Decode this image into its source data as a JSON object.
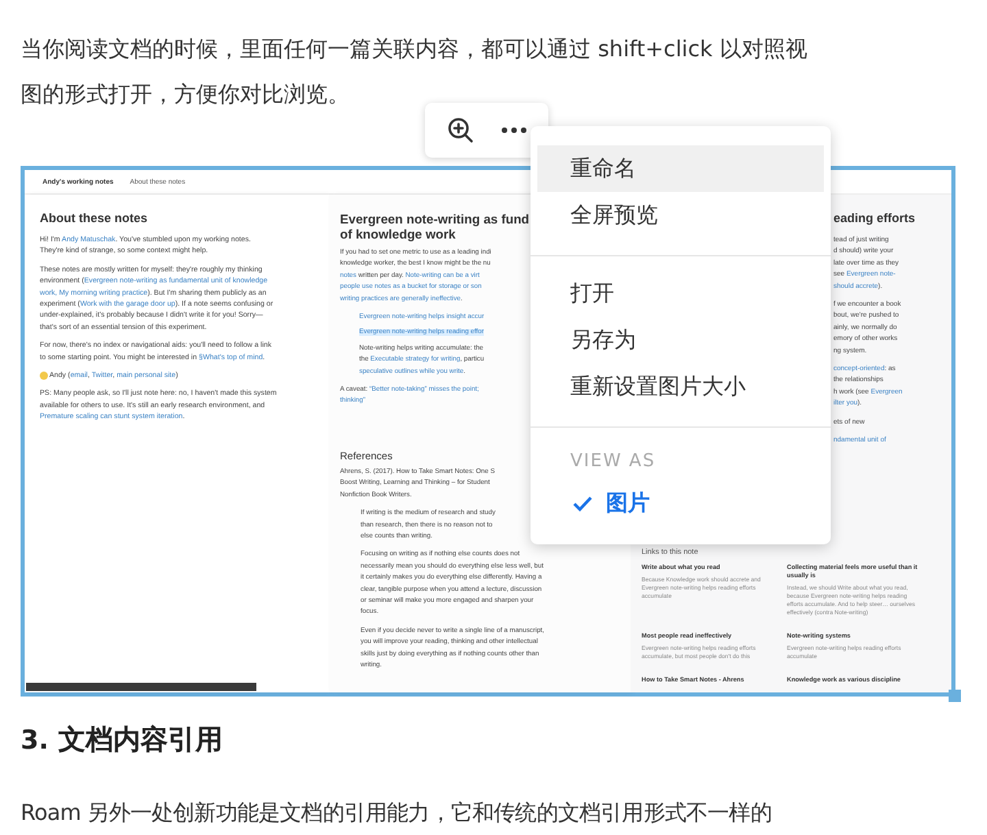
{
  "intro": "当你阅读文档的时候，里面任何一篇关联内容，都可以通过 shift+click 以对照视图的形式打开，方便你对比浏览。",
  "toolbar": [
    {
      "kind": "zoom"
    },
    {
      "kind": "more"
    }
  ],
  "embed": {
    "brand": "Andy's working notes",
    "nav_link": "About these notes",
    "col1": {
      "title": "About these notes",
      "blocks": [
        {
          "kind": "p",
          "lines": [
            [
              "Hi! I'm ",
              {
                "link": "Andy Matuschak"
              },
              ". You've stumbled upon my working notes."
            ],
            [
              "They're kind of strange, so some context might help."
            ]
          ]
        },
        {
          "kind": "p",
          "lines": [
            [
              "These notes are mostly written for myself: they're roughly my thinking"
            ],
            [
              "environment (",
              {
                "link": "Evergreen note-writing as fundamental unit of knowledge"
              }
            ],
            [
              {
                "link": "work, My morning writing practice"
              },
              "). But I'm sharing them publicly as an"
            ],
            [
              "experiment (",
              {
                "link": "Work with the garage door up"
              },
              "). If a note seems confusing or"
            ],
            [
              "under-explained, it's probably because I didn't write it for you! Sorry—"
            ],
            [
              "that's sort of an essential tension of this experiment."
            ]
          ]
        },
        {
          "kind": "p",
          "lines": [
            [
              "For now, there's no index or navigational aids: you'll need to follow a link"
            ],
            [
              "to some starting point. You might be interested in ",
              {
                "link": "§What's top of mind"
              },
              "."
            ]
          ]
        },
        {
          "kind": "sign",
          "lines": [
            [
              "Andy (",
              {
                "link": "email"
              },
              ", ",
              {
                "link": "Twitter"
              },
              ", ",
              {
                "link": "main personal site"
              },
              ")"
            ]
          ]
        },
        {
          "kind": "p",
          "lines": [
            [
              "PS: Many people ask, so I'll just note here: no, I haven't made this system"
            ],
            [
              "available for others to use. It's still an early research environment, and"
            ],
            [
              {
                "link": "Premature scaling can stunt system iteration"
              },
              "."
            ]
          ]
        }
      ]
    },
    "col2": {
      "title": [
        "Evergreen note-writing as fund",
        "of knowledge work"
      ],
      "blocks": [
        {
          "kind": "p",
          "lines": [
            [
              "If you had to set one metric to use as a leading indi"
            ],
            [
              "knowledge worker, the best I know might be the nu"
            ],
            [
              {
                "link": "notes"
              },
              " written per day. ",
              {
                "link": "Note-writing can be a virt"
              }
            ],
            [
              {
                "link": "people use notes as a bucket for storage or son"
              }
            ],
            [
              {
                "link": "writing practices are generally ineffective"
              },
              "."
            ]
          ]
        },
        {
          "kind": "bullets",
          "items": [
            {
              "highlighted": false,
              "lines": [
                [
                  {
                    "link": "Evergreen note-writing helps insight accur"
                  }
                ]
              ]
            },
            {
              "highlighted": true,
              "lines": [
                [
                  {
                    "link": "Evergreen note-writing helps reading effor"
                  }
                ]
              ]
            },
            {
              "highlighted": false,
              "lines": [
                [
                  "Note-writing helps writing accumulate: the"
                ],
                [
                  "the ",
                  {
                    "link": "Executable strategy for writing"
                  },
                  ", particu"
                ],
                [
                  {
                    "link": "speculative outlines while you write"
                  },
                  "."
                ]
              ]
            }
          ]
        },
        {
          "kind": "p",
          "lines": [
            [
              "A caveat: ",
              {
                "link": "“Better note-taking” misses the point;"
              }
            ],
            [
              {
                "link": "thinking”"
              }
            ]
          ]
        },
        {
          "kind": "heading",
          "lines": [
            [
              "References"
            ]
          ]
        },
        {
          "kind": "p",
          "lines": [
            [
              "Ahrens, S. (2017). How to Take Smart Notes: One S"
            ],
            [
              "Boost Writing, Learning and Thinking – for Student"
            ],
            [
              "Nonfiction Book Writers."
            ]
          ]
        },
        {
          "kind": "quote",
          "lines": [
            [
              "If writing is the medium of research and study"
            ],
            [
              "than research, then there is no reason not to"
            ],
            [
              "else counts than writing."
            ]
          ]
        },
        {
          "kind": "quote",
          "lines": [
            [
              "Focusing on writing as if nothing else counts does not"
            ],
            [
              "necessarily mean you should do everything else less well, but"
            ],
            [
              "it certainly makes you do everything else differently. Having a"
            ],
            [
              "clear, tangible purpose when you attend a lecture, discussion"
            ],
            [
              "or seminar will make you more engaged and sharpen your"
            ],
            [
              "focus."
            ]
          ]
        },
        {
          "kind": "quote",
          "lines": [
            [
              "Even if you decide never to write a single line of a manuscript,"
            ],
            [
              "you will improve your reading, thinking and other intellectual"
            ],
            [
              "skills just by doing everything as if nothing counts other than"
            ],
            [
              "writing."
            ]
          ]
        }
      ]
    },
    "col3": {
      "title": "eading efforts",
      "blocks": [
        {
          "kind": "p",
          "lines": [
            [
              "tead of just writing"
            ],
            [
              "d should) write your"
            ],
            [
              "late over time as they"
            ],
            [
              "see ",
              {
                "link": "Evergreen note-"
              }
            ],
            [
              {
                "link": "should accrete"
              },
              ")."
            ]
          ]
        },
        {
          "kind": "p",
          "lines": [
            [
              "f we encounter a book"
            ],
            [
              "bout, we're pushed to"
            ],
            [
              "ainly, we normally do"
            ],
            [
              "emory of other works"
            ],
            [
              "ng system."
            ]
          ]
        },
        {
          "kind": "p",
          "lines": [
            [
              {
                "link": "concept-oriented"
              },
              ": as"
            ],
            [
              "the relationships"
            ],
            [
              "h work (see ",
              {
                "link": "Evergreen"
              }
            ],
            [
              {
                "link": "ilter you"
              },
              ")."
            ]
          ]
        },
        {
          "kind": "p",
          "lines": [
            [
              "ets of new"
            ]
          ]
        },
        {
          "kind": "p",
          "lines": [
            [
              {
                "link": "ndamental unit of"
              }
            ]
          ]
        }
      ],
      "links_title": "Links to this note",
      "links": [
        {
          "title": "Write about what you read",
          "excerpt": "Because Knowledge work should accrete and Evergreen note-writing helps reading efforts accumulate"
        },
        {
          "title": "Collecting material feels more useful than it usually is",
          "excerpt": "Instead, we should Write about what you read, because Evergreen note-writing helps reading efforts accumulate. And to help steer… ourselves effectively (contra Note-writing)"
        },
        {
          "title": "Most people read ineffectively",
          "excerpt": "Evergreen note-writing helps reading efforts accumulate, but most people don't do this"
        },
        {
          "title": "Note-writing systems",
          "excerpt": "Evergreen note-writing helps reading efforts accumulate"
        },
        {
          "title": "How to Take Smart Notes - Ahrens"
        },
        {
          "title": "Knowledge work as various discipline"
        }
      ]
    }
  },
  "menu": {
    "groups": [
      {
        "items": [
          {
            "label": "重命名",
            "highlighted": true
          },
          {
            "label": "全屏预览",
            "highlighted": false
          }
        ]
      },
      {
        "items": [
          {
            "label": "打开",
            "highlighted": false
          },
          {
            "label": "另存为",
            "highlighted": false
          },
          {
            "label": "重新设置图片大小",
            "highlighted": false
          }
        ]
      },
      {
        "heading": "VIEW AS",
        "items": [
          {
            "label": "图片",
            "highlighted": false,
            "checked": true
          }
        ]
      }
    ]
  },
  "section_heading": {
    "number": "3.",
    "title": "文档内容引用"
  },
  "paragraph": "Roam 另外一处创新功能是文档的引用能力，它和传统的文档引用形式不一样的"
}
